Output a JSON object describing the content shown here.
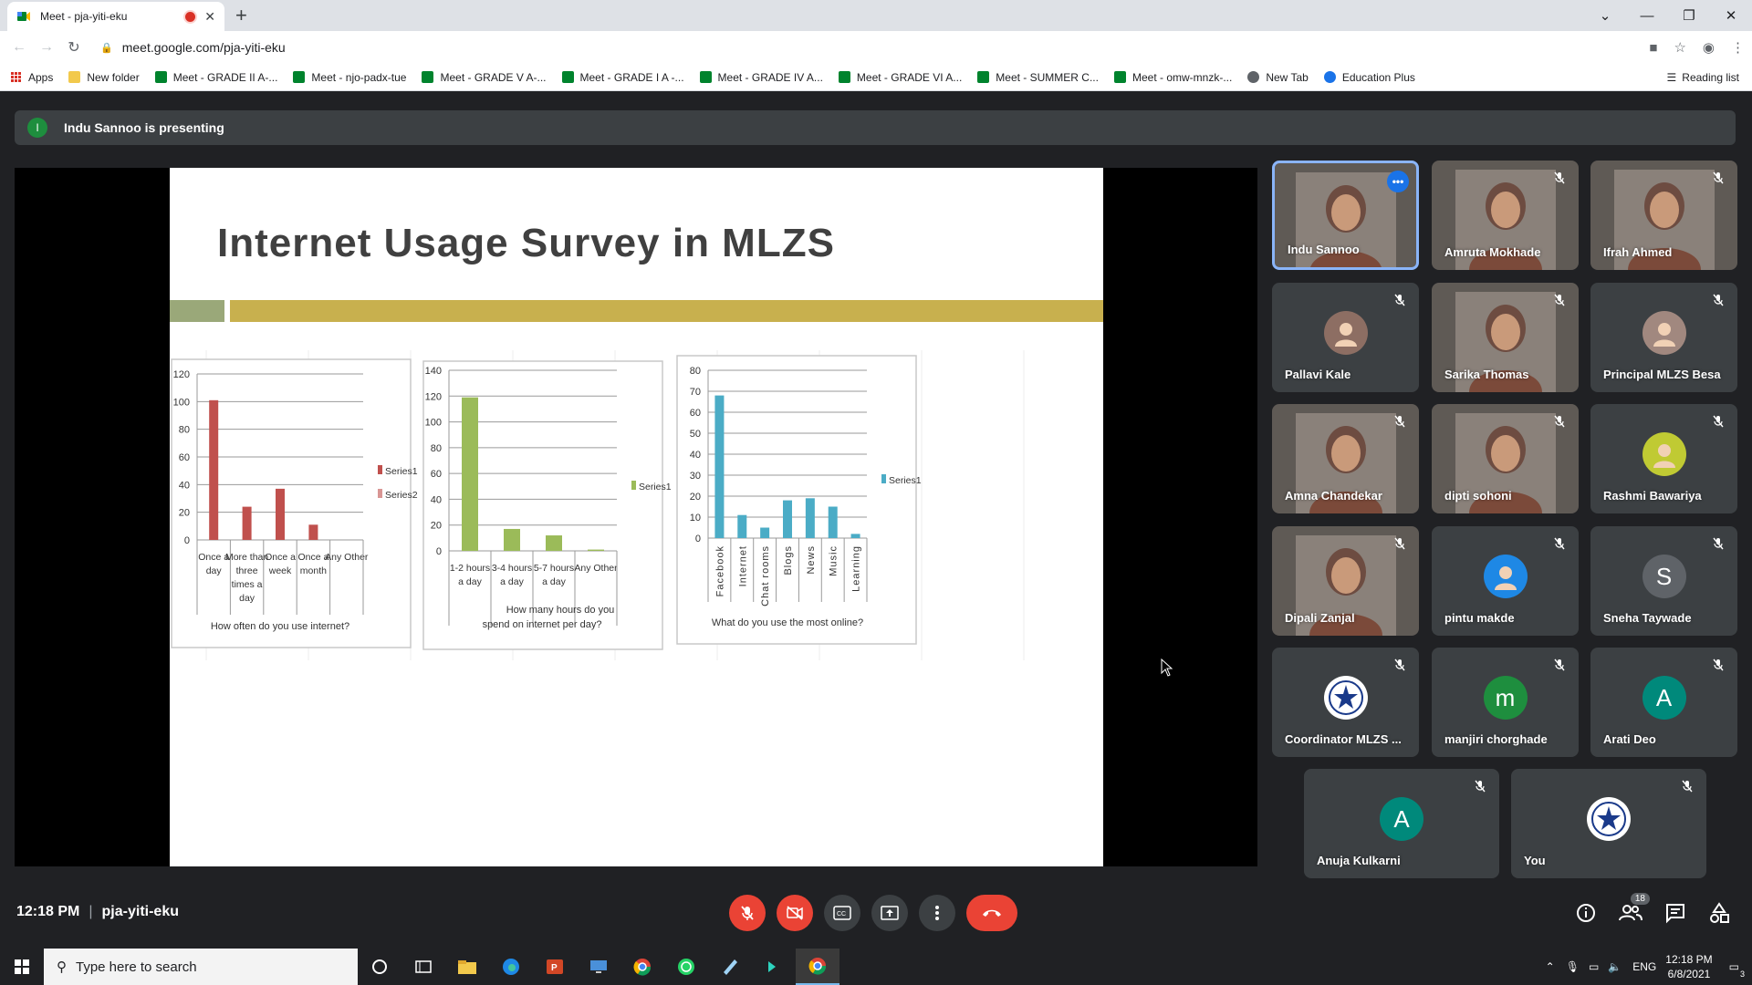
{
  "browser": {
    "tab_title": "Meet - pja-yiti-eku",
    "url": "meet.google.com/pja-yiti-eku",
    "bookmarks": [
      {
        "label": "Apps",
        "icon": "apps-icon"
      },
      {
        "label": "New folder",
        "icon": "folder-icon"
      },
      {
        "label": "Meet - GRADE II A-...",
        "icon": "meet-icon"
      },
      {
        "label": "Meet - njo-padx-tue",
        "icon": "meet-icon"
      },
      {
        "label": "Meet - GRADE V A-...",
        "icon": "meet-icon"
      },
      {
        "label": "Meet - GRADE I A -...",
        "icon": "meet-icon"
      },
      {
        "label": "Meet - GRADE IV A...",
        "icon": "meet-icon"
      },
      {
        "label": "Meet - GRADE VI A...",
        "icon": "meet-icon"
      },
      {
        "label": "Meet - SUMMER C...",
        "icon": "meet-icon"
      },
      {
        "label": "Meet - omw-mnzk-...",
        "icon": "meet-icon"
      },
      {
        "label": "New Tab",
        "icon": "globe-icon"
      },
      {
        "label": "Education Plus",
        "icon": "education-icon"
      }
    ],
    "reading_list": "Reading list"
  },
  "meet": {
    "presenting_initial": "I",
    "presenting_text": "Indu Sannoo is presenting",
    "time": "12:18 PM",
    "meeting_code": "pja-yiti-eku",
    "people_count": "18"
  },
  "slide": {
    "title": "Internet Usage Survey in MLZS",
    "colors": {
      "band_green": "#9aa879",
      "band_gold": "#c8b04e",
      "series_red": "#c0504d",
      "series_green": "#9bbb59",
      "series_blue": "#4bacc6"
    }
  },
  "chart_data": [
    {
      "type": "bar",
      "categories": [
        "Once a day",
        "More than three times a day",
        "Once a week",
        "Once a month",
        "Any Other"
      ],
      "series": [
        {
          "name": "Series1",
          "values": [
            101,
            24,
            37,
            11,
            0
          ]
        },
        {
          "name": "Series2",
          "values": [
            0,
            0,
            0,
            0,
            0
          ]
        }
      ],
      "xlabel": "How often do you use internet?",
      "ylim": [
        0,
        120
      ],
      "yticks": [
        0,
        20,
        40,
        60,
        80,
        100,
        120
      ],
      "legend": "right"
    },
    {
      "type": "bar",
      "categories": [
        "1-2 hours a day",
        "3-4 hours a day",
        "5-7 hours a day",
        "Any Other"
      ],
      "series": [
        {
          "name": "Series1",
          "values": [
            119,
            17,
            12,
            1
          ]
        }
      ],
      "xlabel": "How many hours do you spend on internet per day?",
      "ylim": [
        0,
        140
      ],
      "yticks": [
        0,
        20,
        40,
        60,
        80,
        100,
        120,
        140
      ],
      "legend": "right"
    },
    {
      "type": "bar",
      "categories": [
        "Facebook",
        "Internet",
        "Chat rooms",
        "Blogs",
        "News",
        "Music",
        "Learning"
      ],
      "series": [
        {
          "name": "Series1",
          "values": [
            68,
            11,
            5,
            18,
            19,
            15,
            2
          ]
        }
      ],
      "xlabel": "What do you use the most online?",
      "ylim": [
        0,
        80
      ],
      "yticks": [
        0,
        10,
        20,
        30,
        40,
        50,
        60,
        70,
        80
      ],
      "legend": "right"
    }
  ],
  "participants": [
    {
      "name": "Indu Sannoo",
      "kind": "video",
      "active": true
    },
    {
      "name": "Amruta Mokhade",
      "kind": "video"
    },
    {
      "name": "Ifrah Ahmed",
      "kind": "video"
    },
    {
      "name": "Pallavi Kale",
      "kind": "photo",
      "color": "#8d6e63"
    },
    {
      "name": "Sarika Thomas",
      "kind": "video"
    },
    {
      "name": "Principal MLZS Besa",
      "kind": "photo",
      "color": "#a1887f"
    },
    {
      "name": "Amna Chandekar",
      "kind": "video"
    },
    {
      "name": "dipti sohoni",
      "kind": "video"
    },
    {
      "name": "Rashmi Bawariya",
      "kind": "photo",
      "color": "#c0ca33"
    },
    {
      "name": "Dipali Zanjal",
      "kind": "video"
    },
    {
      "name": "pintu makde",
      "kind": "photo",
      "color": "#1e88e5"
    },
    {
      "name": "Sneha Taywade",
      "kind": "letter",
      "letter": "S",
      "color": "#5f6368"
    },
    {
      "name": "Coordinator MLZS ...",
      "kind": "logo"
    },
    {
      "name": "manjiri chorghade",
      "kind": "letter",
      "letter": "m",
      "color": "#1e8e3e"
    },
    {
      "name": "Arati Deo",
      "kind": "letter",
      "letter": "A",
      "color": "#00897b"
    },
    {
      "name": "Anuja Kulkarni",
      "kind": "letter",
      "letter": "A",
      "color": "#00897b"
    },
    {
      "name": "You",
      "kind": "logo"
    }
  ],
  "taskbar": {
    "search_placeholder": "Type here to search",
    "lang": "ENG",
    "time": "12:18 PM",
    "date": "6/8/2021",
    "notif_count": "3"
  }
}
